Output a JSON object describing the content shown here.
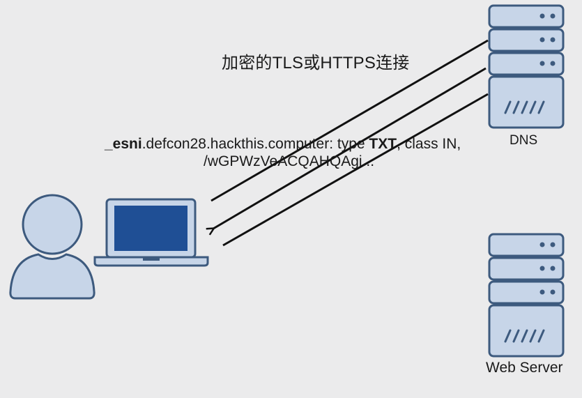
{
  "title": "加密的TLS或HTTPS连接",
  "dns_query": {
    "name_prefix": "_esni",
    "name_rest": ".defcon28.hackthis.computer: type ",
    "type": "TXT",
    "class_part": ", class IN,",
    "data": "/wGPWzVeACQAHQAgi..."
  },
  "dns_server": {
    "label": "DNS",
    "icon": "server-rack-icon"
  },
  "web_server": {
    "label": "Web Server",
    "icon": "server-rack-icon"
  },
  "user": {
    "icon": "user-icon"
  },
  "laptop": {
    "icon": "laptop-icon"
  },
  "colors": {
    "background": "#ebebec",
    "outline": "#3d5a7e",
    "fill": "#c7d5e8",
    "screen": "#1f4f95",
    "line": "#111111"
  }
}
